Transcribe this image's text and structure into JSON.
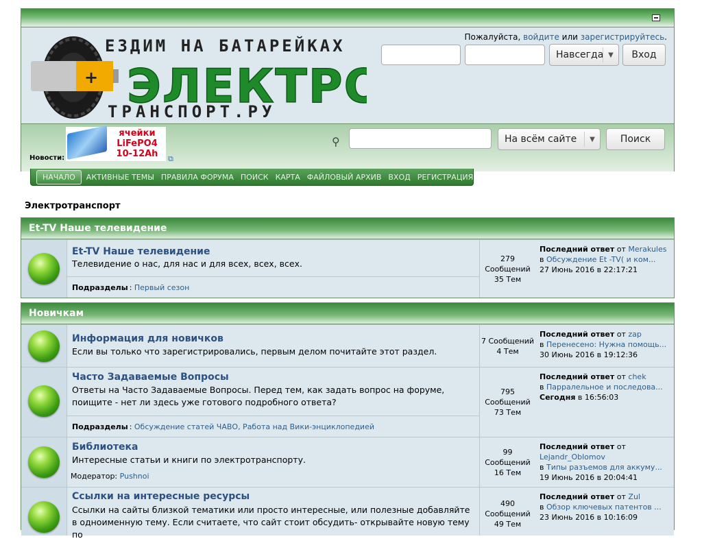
{
  "header": {
    "logo": {
      "line1": "ЕЗДИМ НА БАТАРЕЙКАХ",
      "line2": "ЭЛЕКТРО",
      "line3": "ТРАНСПОРТ.РУ"
    },
    "login_prompt": "Пожалуйста,",
    "login_link": "войдите",
    "or": "или",
    "register_link": "зарегистрируйтесь",
    "remember_value": "Навсегда",
    "login_button": "Вход",
    "news_label": "Новости:",
    "banner_text": [
      "ячейки",
      "LiFePO4",
      "10-12Ah"
    ],
    "search_scope": "На всём сайте",
    "search_button": "Поиск"
  },
  "nav": [
    "НАЧАЛО",
    "АКТИВНЫЕ ТЕМЫ",
    "ПРАВИЛА ФОРУМА",
    "ПОИСК",
    "КАРТА",
    "ФАЙЛОВЫЙ АРХИВ",
    "ВХОД",
    "РЕГИСТРАЦИЯ"
  ],
  "breadcrumb": "Электротранспорт",
  "categories": [
    {
      "name": "Et-TV Наше телевидение",
      "boards": [
        {
          "title": "Et-TV Наше телевидение",
          "desc": "Телевидение о нас, для нас и для всех, всех, всех.",
          "sub_label": "Подразделы",
          "subs": "Первый сезон",
          "stats": [
            "279",
            "Сообщений",
            "35 Тем"
          ],
          "last": {
            "label": "Последний ответ",
            "from": "от",
            "user": "Merakules",
            "in": "в",
            "topic": "Обсуждение Et -TV( и ком...",
            "date": "27 Июнь 2016 в 22:17:21"
          }
        }
      ]
    },
    {
      "name": "Новичкам",
      "boards": [
        {
          "title": "Информация для новичков",
          "desc": "Если вы только что зарегистрировались, первым делом почитайте этот раздел.",
          "stats": [
            "7 Сообщений",
            "4 Тем"
          ],
          "last": {
            "label": "Последний ответ",
            "from": "от",
            "user": "zap",
            "in": "в",
            "topic": "Перенесено: Нужна помощь...",
            "date": "30 Июнь 2016 в 19:12:36"
          }
        },
        {
          "title": "Часто Задаваемые Вопросы",
          "desc": "Ответы на Часто Задаваемые Вопросы. Перед тем, как задать вопрос на форуме, поищите - нет ли здесь уже готового подробного ответа?",
          "sub_label": "Подразделы",
          "subs": "Обсуждение статей ЧАВО, Работа над Вики-энциклопедией",
          "stats": [
            "795",
            "Сообщений",
            "73 Тем"
          ],
          "last": {
            "label": "Последний ответ",
            "from": "от",
            "user": "chek",
            "in": "в",
            "topic": "Парралельное и последова...",
            "date_bold": "Сегодня",
            "date": "в 16:56:03"
          }
        },
        {
          "title": "Библиотека",
          "desc": "Интересные статьи и книги по электротранспорту.",
          "mod_label": "Модератор:",
          "mod": "Pushnoi",
          "stats": [
            "99 Сообщений",
            "16 Тем"
          ],
          "last": {
            "label": "Последний ответ",
            "from": "от",
            "user": "Lejandr_Oblomov",
            "in": "в",
            "topic": "Типы разъемов для аккуму...",
            "date": "19 Июнь 2016 в 20:04:41"
          }
        },
        {
          "title": "Ссылки на интересные ресурсы",
          "desc": "Ссылки на сайты близкой тематики или просто интересные, или полезные добавляйте в одноименную тему. Если считаете, что сайт стоит обсудить- открывайте новую тему по",
          "stats": [
            "490",
            "Сообщений",
            "49 Тем"
          ],
          "last": {
            "label": "Последний ответ",
            "from": "от",
            "user": "Zul",
            "in": "в",
            "topic": "Обзор ключевых патентов ...",
            "date": "23 Июнь 2016 в 10:16:09"
          }
        }
      ]
    }
  ]
}
